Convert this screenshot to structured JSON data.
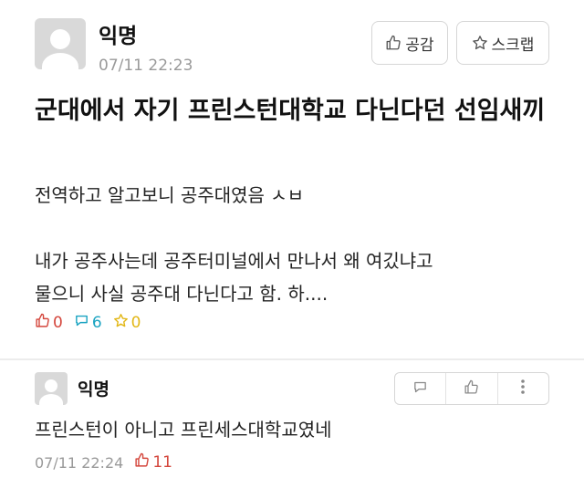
{
  "post": {
    "author": "익명",
    "time": "07/11 22:23",
    "like_button": "공감",
    "scrap_button": "스크랩",
    "title": "군대에서 자기 프린스턴대학교 다닌다던 선임새끼",
    "body": [
      "전역하고 알고보니 공주대였음 ㅅㅂ",
      "",
      "내가 공주사는데 공주터미널에서 만나서 왜 여깄냐고",
      "물으니 사실 공주대 다닌다고 함. 하...."
    ],
    "likes": "0",
    "comments": "6",
    "scraps": "0"
  },
  "comment": {
    "author": "익명",
    "text": "프린스턴이 아니고 프린세스대학교였네",
    "time": "07/11 22:24",
    "likes": "11"
  },
  "colors": {
    "like": "#d4463c",
    "comment": "#19a3c1",
    "scrap": "#e2b716",
    "muted": "#9a9a9a"
  },
  "icons": [
    "thumbs-up-icon",
    "star-icon",
    "speech-bubble-icon",
    "more-vertical-icon",
    "avatar-icon"
  ]
}
